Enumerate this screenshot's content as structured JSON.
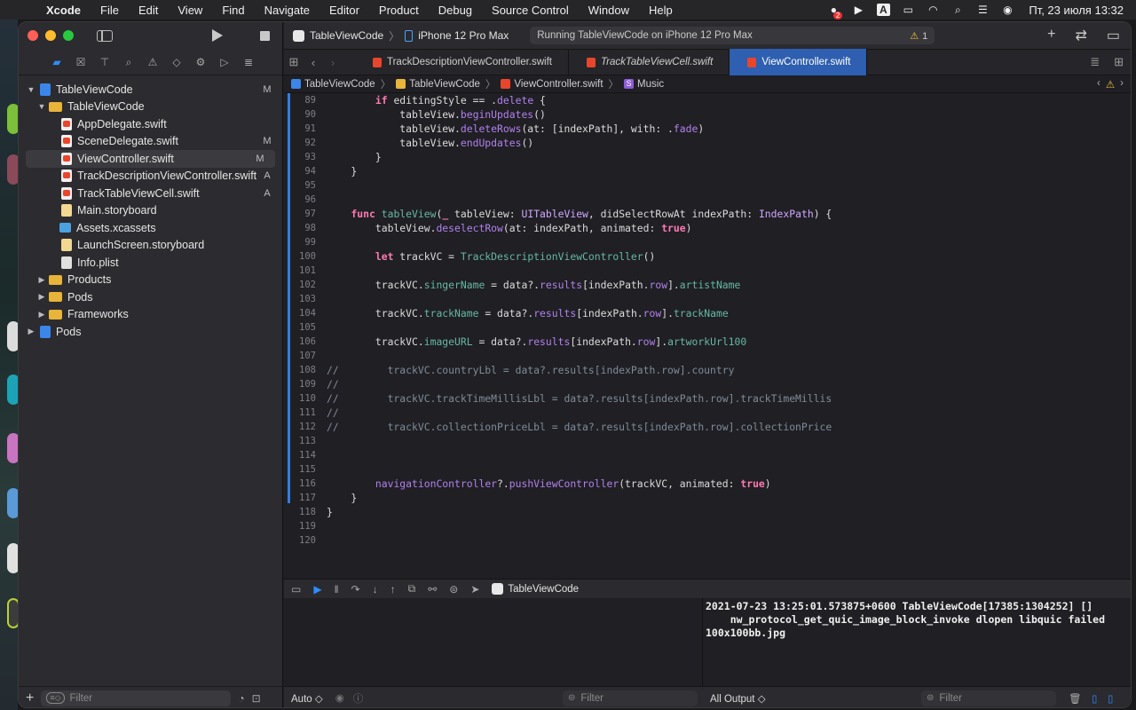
{
  "menubar": {
    "app": "Xcode",
    "items": [
      "File",
      "Edit",
      "View",
      "Find",
      "Navigate",
      "Editor",
      "Product",
      "Debug",
      "Source Control",
      "Window",
      "Help"
    ],
    "notification_badge": "2",
    "keyboard": "A",
    "datetime": "Пт, 23 июля  13:32"
  },
  "toolbar": {
    "scheme": "TableViewCode",
    "device": "iPhone 12 Pro Max",
    "activity": "Running TableViewCode on iPhone 12 Pro Max",
    "warnings": "1"
  },
  "navigator": {
    "items": [
      {
        "label": "TableViewCode",
        "status": "M",
        "icon": "project-icon"
      },
      {
        "label": "TableViewCode",
        "status": "",
        "icon": "folder-icon"
      },
      {
        "label": "AppDelegate.swift",
        "status": "",
        "icon": "swift-file-icon"
      },
      {
        "label": "SceneDelegate.swift",
        "status": "M",
        "icon": "swift-file-icon"
      },
      {
        "label": "ViewController.swift",
        "status": "M",
        "icon": "swift-file-icon"
      },
      {
        "label": "TrackDescriptionViewController.swift",
        "status": "A",
        "icon": "swift-file-icon"
      },
      {
        "label": "TrackTableViewCell.swift",
        "status": "A",
        "icon": "swift-file-icon"
      },
      {
        "label": "Main.storyboard",
        "status": "",
        "icon": "storyboard-icon"
      },
      {
        "label": "Assets.xcassets",
        "status": "",
        "icon": "assets-icon"
      },
      {
        "label": "LaunchScreen.storyboard",
        "status": "",
        "icon": "storyboard-icon"
      },
      {
        "label": "Info.plist",
        "status": "",
        "icon": "plist-icon"
      },
      {
        "label": "Products",
        "status": "",
        "icon": "folder-icon"
      },
      {
        "label": "Pods",
        "status": "",
        "icon": "folder-icon"
      },
      {
        "label": "Frameworks",
        "status": "",
        "icon": "folder-icon"
      },
      {
        "label": "Pods",
        "status": "",
        "icon": "project-icon"
      }
    ],
    "filter_placeholder": "Filter"
  },
  "tabs": [
    {
      "label": "TrackDescriptionViewController.swift"
    },
    {
      "label": "TrackTableViewCell.swift"
    },
    {
      "label": "ViewController.swift"
    }
  ],
  "jumpbar": {
    "project": "TableViewCode",
    "group": "TableViewCode",
    "file": "ViewController.swift",
    "symbol": "Music"
  },
  "debug": {
    "target": "TableViewCode",
    "console_text": "2021-07-23 13:25:01.573875+0600 TableViewCode[17385:1304252] []\n    nw_protocol_get_quic_image_block_invoke dlopen libquic failed\n100x100bb.jpg",
    "auto_label": "Auto ◇",
    "filter_placeholder": "Filter",
    "output_label": "All Output ◇",
    "console_filter_placeholder": "Filter"
  }
}
